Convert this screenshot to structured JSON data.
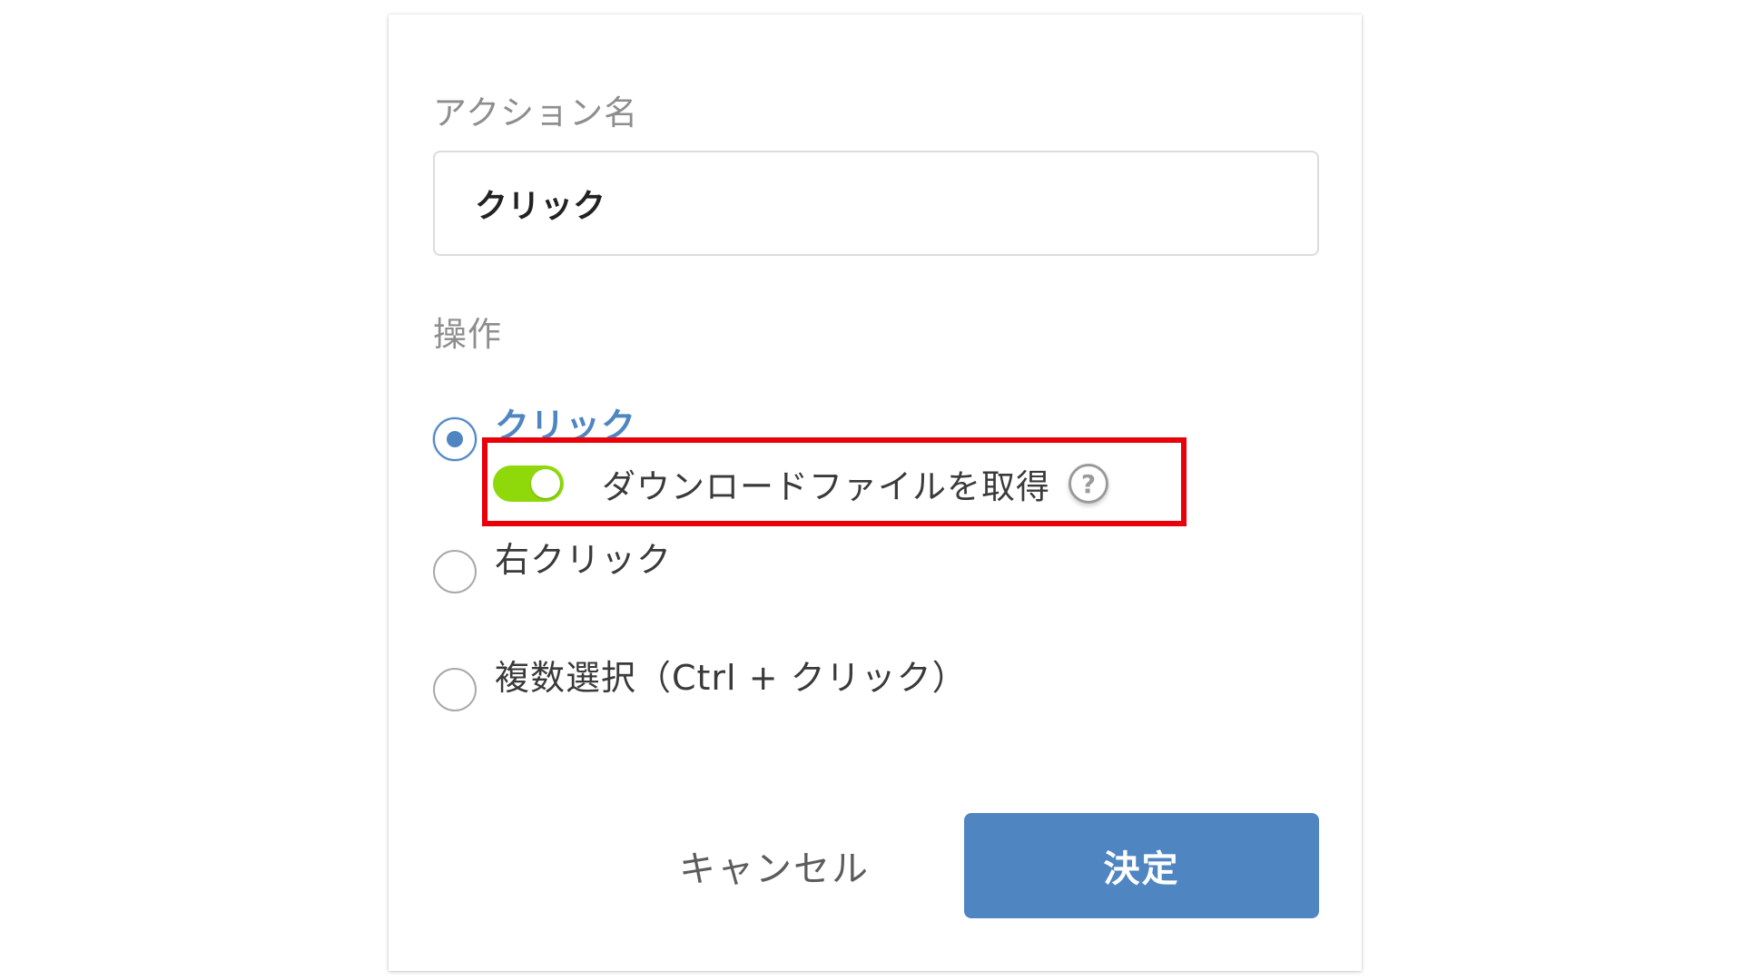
{
  "dialog": {
    "action_name_label": "アクション名",
    "action_name_value": "クリック",
    "operation_label": "操作",
    "options": [
      {
        "label": "クリック",
        "selected": true
      },
      {
        "label": "右クリック",
        "selected": false
      },
      {
        "label": "複数選択（Ctrl + クリック）",
        "selected": false
      }
    ],
    "download_toggle": {
      "label": "ダウンロードファイルを取得",
      "on": true,
      "help_symbol": "?"
    },
    "cancel_label": "キャンセル",
    "ok_label": "決定"
  },
  "colors": {
    "accent": "#4f86c2",
    "toggle_on": "#8fd90a",
    "highlight": "#e8000b"
  }
}
